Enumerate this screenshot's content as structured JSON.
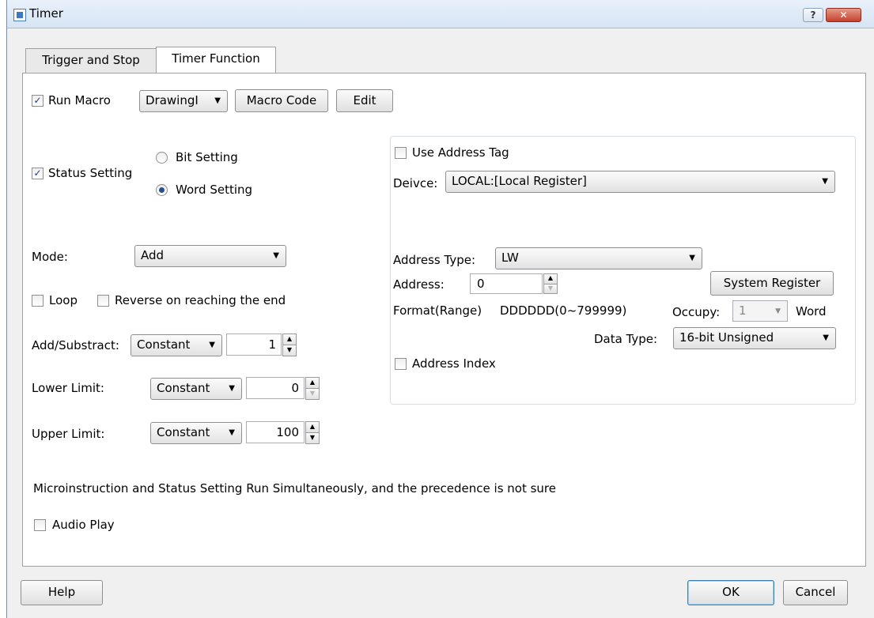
{
  "window": {
    "title": "Timer",
    "help_glyph": "?",
    "close_glyph": "✕"
  },
  "tabs": [
    {
      "label": "Trigger and Stop",
      "active": false
    },
    {
      "label": "Timer Function",
      "active": true
    }
  ],
  "macro": {
    "run_macro_label": "Run Macro",
    "run_macro_checked": true,
    "macro_select_value": "DrawingI",
    "macro_code_label": "Macro Code",
    "edit_label": "Edit"
  },
  "status": {
    "status_setting_label": "Status Setting",
    "status_setting_checked": true,
    "bit_setting_label": "Bit Setting",
    "word_setting_label": "Word Setting",
    "selected": "word"
  },
  "mode": {
    "label": "Mode:",
    "value": "Add"
  },
  "loop": {
    "loop_label": "Loop",
    "loop_checked": false,
    "reverse_label": "Reverse on reaching the end",
    "reverse_checked": false
  },
  "add_substract": {
    "label": "Add/Substract:",
    "type": "Constant",
    "value": "1"
  },
  "lower_limit": {
    "label": "Lower Limit:",
    "type": "Constant",
    "value": "0"
  },
  "upper_limit": {
    "label": "Upper Limit:",
    "type": "Constant",
    "value": "100"
  },
  "address_group": {
    "use_address_tag_label": "Use Address Tag",
    "use_address_tag_checked": false,
    "device_label": "Deivce:",
    "device_value": "LOCAL:[Local Register]",
    "address_type_label": "Address Type:",
    "address_type_value": "LW",
    "address_label": "Address:",
    "address_value": "0",
    "system_register_label": "System Register",
    "format_label": "Format(Range)",
    "format_value": "DDDDDD(0~799999)",
    "occupy_label": "Occupy:",
    "occupy_value": "1",
    "occupy_unit": "Word",
    "data_type_label": "Data Type:",
    "data_type_value": "16-bit Unsigned",
    "address_index_label": "Address Index",
    "address_index_checked": false
  },
  "note": "Microinstruction and Status Setting Run Simultaneously, and the precedence is not sure",
  "audio": {
    "label": "Audio Play",
    "checked": false
  },
  "footer": {
    "help_label": "Help",
    "ok_label": "OK",
    "cancel_label": "Cancel"
  },
  "glyphs": {
    "check": "✓",
    "dropdown": "▼",
    "up": "▲",
    "down": "▼"
  }
}
